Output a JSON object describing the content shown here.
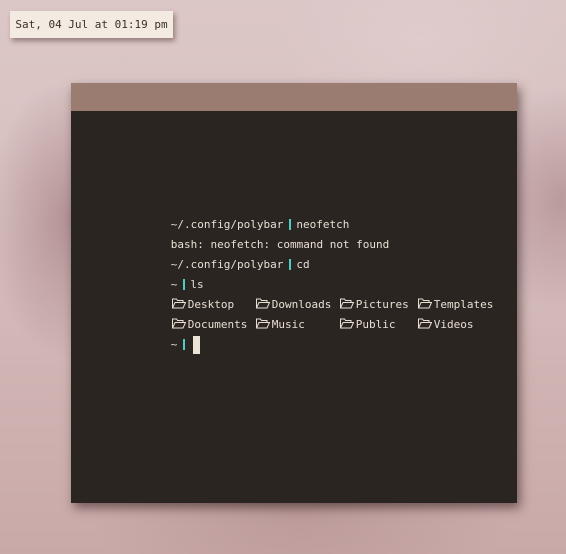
{
  "clock": {
    "text": "Sat, 04 Jul at 01:19 pm"
  },
  "terminal": {
    "lines": [
      {
        "prompt": "~/.config/polybar",
        "command": "neofetch"
      },
      {
        "output": "bash: neofetch: command not found"
      },
      {
        "prompt": "~/.config/polybar",
        "command": "cd"
      },
      {
        "prompt": "~",
        "command": "ls"
      }
    ],
    "ls_items": [
      "Desktop",
      "Downloads",
      "Pictures",
      "Templates",
      "Documents",
      "Music",
      "Public",
      "Videos"
    ],
    "current_prompt": "~"
  },
  "colors": {
    "titlebar": "#9a7d70",
    "terminal_bg": "#2b2521",
    "terminal_fg": "#e8ded3",
    "prompt_separator": "#4ecdc4",
    "clock_bg": "#f3ebe2"
  },
  "icons": {
    "ls_item": "folder-open-icon",
    "prompt_separator": "prompt-separator-icon"
  }
}
